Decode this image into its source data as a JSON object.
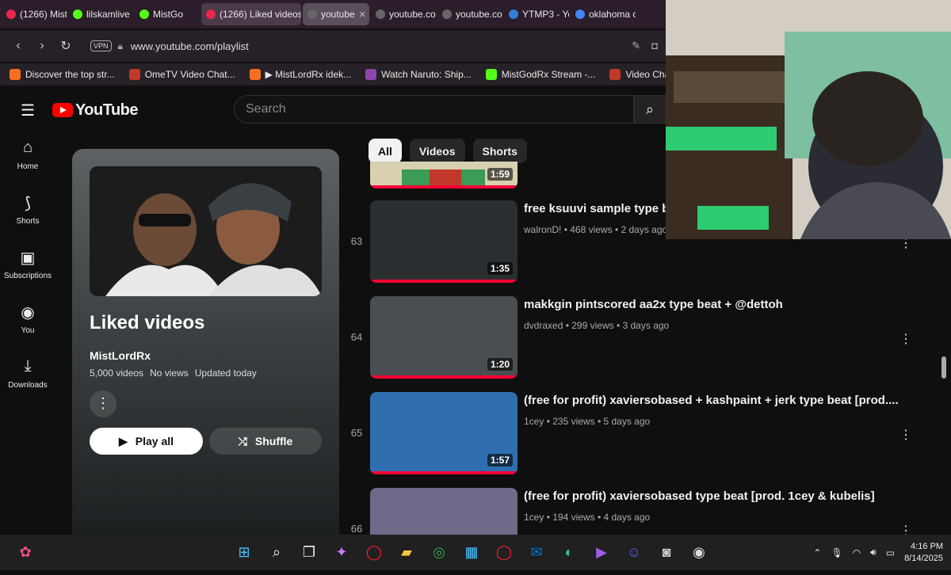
{
  "browser": {
    "tabs": [
      {
        "label": "(1266) Mist",
        "fav": "#e8274b",
        "state": "normal",
        "has_close": false
      },
      {
        "label": "lilskamlive",
        "fav": "#53fc18",
        "state": "normal",
        "has_close": false
      },
      {
        "label": "MistGo",
        "fav": "#53fc18",
        "state": "normal",
        "has_close": false
      },
      {
        "label": "(1266) Liked videos",
        "fav": "#e8274b",
        "state": "active",
        "has_close": false
      },
      {
        "label": "youtube",
        "fav": "#666666",
        "state": "hover",
        "has_close": true
      },
      {
        "label": "youtube.co",
        "fav": "#666666",
        "state": "normal",
        "has_close": false
      },
      {
        "label": "youtube.co",
        "fav": "#666666",
        "state": "normal",
        "has_close": false
      },
      {
        "label": "YTMP3 - Yo",
        "fav": "#2f7ed8",
        "state": "normal",
        "has_close": false
      },
      {
        "label": "oklahoma c",
        "fav": "#4285f4",
        "state": "normal",
        "has_close": false
      }
    ],
    "url": "www.youtube.com/playlist",
    "vpn_label": "VPN",
    "bookmarks": [
      {
        "label": "Discover the top str...",
        "icon_color": "#f36f21"
      },
      {
        "label": "OmeTV Video Chat...",
        "icon_color": "#c0392b"
      },
      {
        "label": "▶ MistLordRx idek...",
        "icon_color": "#f36f21"
      },
      {
        "label": "Watch Naruto: Ship...",
        "icon_color": "#8e44ad"
      },
      {
        "label": "MistGodRx Stream -...",
        "icon_color": "#53fc18"
      },
      {
        "label": "Video Chat OmeTV...",
        "icon_color": "#c0392b"
      }
    ]
  },
  "youtube": {
    "logo_text": "YouTube",
    "search_placeholder": "Search",
    "sidebar": [
      {
        "label": "Home",
        "icon": "home-icon",
        "glyph": "⌂"
      },
      {
        "label": "Shorts",
        "icon": "shorts-icon",
        "glyph": "⟆"
      },
      {
        "label": "Subscriptions",
        "icon": "subscriptions-icon",
        "glyph": "▣"
      },
      {
        "label": "You",
        "icon": "you-icon",
        "glyph": "◉"
      },
      {
        "label": "Downloads",
        "icon": "downloads-icon",
        "glyph": "⤓"
      }
    ],
    "playlist": {
      "title": "Liked videos",
      "owner": "MistLordRx",
      "video_count": "5,000 videos",
      "views": "No views",
      "updated": "Updated today",
      "play_all": "Play all",
      "shuffle": "Shuffle"
    },
    "chips": [
      {
        "label": "All",
        "selected": true
      },
      {
        "label": "Videos",
        "selected": false
      },
      {
        "label": "Shorts",
        "selected": false
      }
    ],
    "partial_video": {
      "duration": "1:59"
    },
    "videos": [
      {
        "index": "63",
        "title": "free ksuuvi sample type be",
        "channel": "walronD!",
        "views": "468 views",
        "age": "2 days ago",
        "duration": "1:35",
        "thumb": "#2a2e31"
      },
      {
        "index": "64",
        "title": "makkgin pintscored aa2x type beat + @dettoh",
        "channel": "dvdraxed",
        "views": "299 views",
        "age": "3 days ago",
        "duration": "1:20",
        "thumb": "#4a4e52"
      },
      {
        "index": "65",
        "title": "(free for profit) xaviersobased + kashpaint + jerk type beat [prod....",
        "channel": "1cey",
        "views": "235 views",
        "age": "5 days ago",
        "duration": "1:57",
        "thumb": "#2f6fb0"
      },
      {
        "index": "66",
        "title": "(free for profit) xaviersobased type beat [prod. 1cey & kubelis]",
        "channel": "1cey",
        "views": "194 views",
        "age": "4 days ago",
        "duration": "",
        "thumb": "#6e6a8a"
      }
    ]
  },
  "taskbar": {
    "apps": [
      {
        "name": "windows-start-icon",
        "glyph": "⊞",
        "color": "#4cc2ff"
      },
      {
        "name": "search-icon",
        "glyph": "⌕",
        "color": "#eeeeee"
      },
      {
        "name": "task-view-icon",
        "glyph": "❐",
        "color": "#eeeeee"
      },
      {
        "name": "copilot-icon",
        "glyph": "✦",
        "color": "#c77dff"
      },
      {
        "name": "opera-icon",
        "glyph": "◯",
        "color": "#ff1b2d"
      },
      {
        "name": "file-explorer-icon",
        "glyph": "▰",
        "color": "#f4c542"
      },
      {
        "name": "chrome-icon",
        "glyph": "◎",
        "color": "#34a853"
      },
      {
        "name": "microsoft-store-icon",
        "glyph": "▦",
        "color": "#4cc2ff"
      },
      {
        "name": "opera-gx-icon",
        "glyph": "◯",
        "color": "#ff1b2d"
      },
      {
        "name": "outlook-icon",
        "glyph": "✉",
        "color": "#0078d4"
      },
      {
        "name": "edge-icon",
        "glyph": "◐",
        "color": "#2ec4a5"
      },
      {
        "name": "clipchamp-icon",
        "glyph": "▶",
        "color": "#9b5de5"
      },
      {
        "name": "discord-icon",
        "glyph": "☺",
        "color": "#5865f2"
      },
      {
        "name": "camera-icon",
        "glyph": "◙",
        "color": "#cccccc"
      },
      {
        "name": "obs-icon",
        "glyph": "◉",
        "color": "#dddddd"
      }
    ],
    "time": "4:16 PM",
    "date": "8/14/2025"
  }
}
